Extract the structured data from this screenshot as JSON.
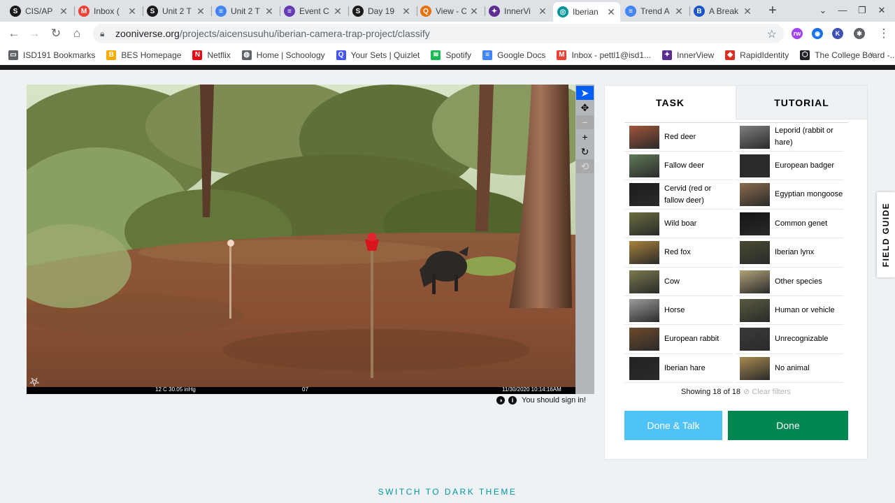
{
  "browser": {
    "tabs": [
      {
        "title": "CIS/AP",
        "icon": "schoology-icon",
        "color": "#1a1a1a",
        "glyph": "S"
      },
      {
        "title": "Inbox (",
        "icon": "gmail-icon",
        "color": "#ea4335",
        "glyph": "M"
      },
      {
        "title": "Unit 2 T",
        "icon": "schoology-icon",
        "color": "#1a1a1a",
        "glyph": "S"
      },
      {
        "title": "Unit 2 T",
        "icon": "google-docs-icon",
        "color": "#4285f4",
        "glyph": "≡"
      },
      {
        "title": "Event C",
        "icon": "google-forms-icon",
        "color": "#673ab7",
        "glyph": "≡"
      },
      {
        "title": "Day 19",
        "icon": "schoology-icon",
        "color": "#1a1a1a",
        "glyph": "S"
      },
      {
        "title": "View - C",
        "icon": "view-icon",
        "color": "#e8710a",
        "glyph": "Q"
      },
      {
        "title": "InnerVi",
        "icon": "innerview-icon",
        "color": "#5c2d91",
        "glyph": "✦"
      },
      {
        "title": "Iberian",
        "icon": "zooniverse-icon",
        "color": "#00979d",
        "glyph": "◎"
      },
      {
        "title": "Trend A",
        "icon": "google-docs-icon",
        "color": "#4285f4",
        "glyph": "≡"
      },
      {
        "title": "A Break",
        "icon": "b-icon",
        "color": "#1a56c7",
        "glyph": "B"
      }
    ],
    "active_tab": 8,
    "url_host": "zooniverse.org",
    "url_path": "/projects/aicensusuhu/iberian-camera-trap-project/classify",
    "extensions": [
      {
        "name": "rw-extension-icon",
        "color": "#a142f4",
        "glyph": "rw"
      },
      {
        "name": "shield-extension-icon",
        "color": "#1a73e8",
        "glyph": "◉"
      },
      {
        "name": "k-extension-icon",
        "color": "#3f51b5",
        "glyph": "K"
      },
      {
        "name": "puzzle-extension-icon",
        "color": "#5f6368",
        "glyph": "✱"
      }
    ],
    "bookmarks": [
      {
        "label": "ISD191 Bookmarks",
        "icon": "folder-icon",
        "color": "#5f6368",
        "glyph": "▭"
      },
      {
        "label": "BES Homepage",
        "icon": "bes-icon",
        "color": "#f9ab00",
        "glyph": "B"
      },
      {
        "label": "Netflix",
        "icon": "netflix-icon",
        "color": "#e50914",
        "glyph": "N"
      },
      {
        "label": "Home | Schoology",
        "icon": "globe-icon",
        "color": "#5f6368",
        "glyph": "◍"
      },
      {
        "label": "Your Sets | Quizlet",
        "icon": "quizlet-icon",
        "color": "#4255ff",
        "glyph": "Q"
      },
      {
        "label": "Spotify",
        "icon": "spotify-icon",
        "color": "#1db954",
        "glyph": "≋"
      },
      {
        "label": "Google Docs",
        "icon": "google-docs-icon",
        "color": "#4285f4",
        "glyph": "≡"
      },
      {
        "label": "Inbox - pettl1@isd1...",
        "icon": "gmail-icon",
        "color": "#ea4335",
        "glyph": "M"
      },
      {
        "label": "InnerView",
        "icon": "innerview-icon",
        "color": "#5c2d91",
        "glyph": "✦"
      },
      {
        "label": "RapidIdentity",
        "icon": "rapididentity-icon",
        "color": "#d93025",
        "glyph": "◆"
      },
      {
        "label": "The College Board -...",
        "icon": "college-board-icon",
        "color": "#202124",
        "glyph": "⬡"
      }
    ],
    "bookmarks_more": "»"
  },
  "subject": {
    "overlay_left": "12 C  30.05 inHg",
    "overlay_center": "07",
    "overlay_right": "11/30/2020 10:14:16AM",
    "sign_in_note": "You should sign in!"
  },
  "task_panel": {
    "tab_task": "TASK",
    "tab_tutorial": "TUTORIAL",
    "choices": [
      {
        "label": "Red deer",
        "thumb": "#a0553a"
      },
      {
        "label": "Leporid (rabbit or hare)",
        "thumb": "#7e7e7e"
      },
      {
        "label": "Fallow deer",
        "thumb": "#607a58"
      },
      {
        "label": "European badger",
        "thumb": "#2a2a2a"
      },
      {
        "label": "Cervid (red or fallow deer)",
        "thumb": "#1c1c1c"
      },
      {
        "label": "Egyptian mongoose",
        "thumb": "#8b6a4c"
      },
      {
        "label": "Wild boar",
        "thumb": "#6b6e40"
      },
      {
        "label": "Common genet",
        "thumb": "#141414"
      },
      {
        "label": "Red fox",
        "thumb": "#a8823a"
      },
      {
        "label": "Iberian lynx",
        "thumb": "#4a4a32"
      },
      {
        "label": "Cow",
        "thumb": "#7a7a4e"
      },
      {
        "label": "Other species",
        "thumb": "#b0a278"
      },
      {
        "label": "Horse",
        "thumb": "#9c9c9c"
      },
      {
        "label": "Human or vehicle",
        "thumb": "#5a5a40"
      },
      {
        "label": "European rabbit",
        "thumb": "#6d4a2a"
      },
      {
        "label": "Unrecognizable",
        "thumb": "#3a3a3a"
      },
      {
        "label": "Iberian hare",
        "thumb": "#222222"
      },
      {
        "label": "No animal",
        "thumb": "#a88a50"
      }
    ],
    "showing": "Showing 18 of 18",
    "clear_filters": "Clear filters",
    "done_talk": "Done & Talk",
    "done": "Done"
  },
  "field_guide": "FIELD GUIDE",
  "switch_theme": "SWITCH TO DARK THEME"
}
